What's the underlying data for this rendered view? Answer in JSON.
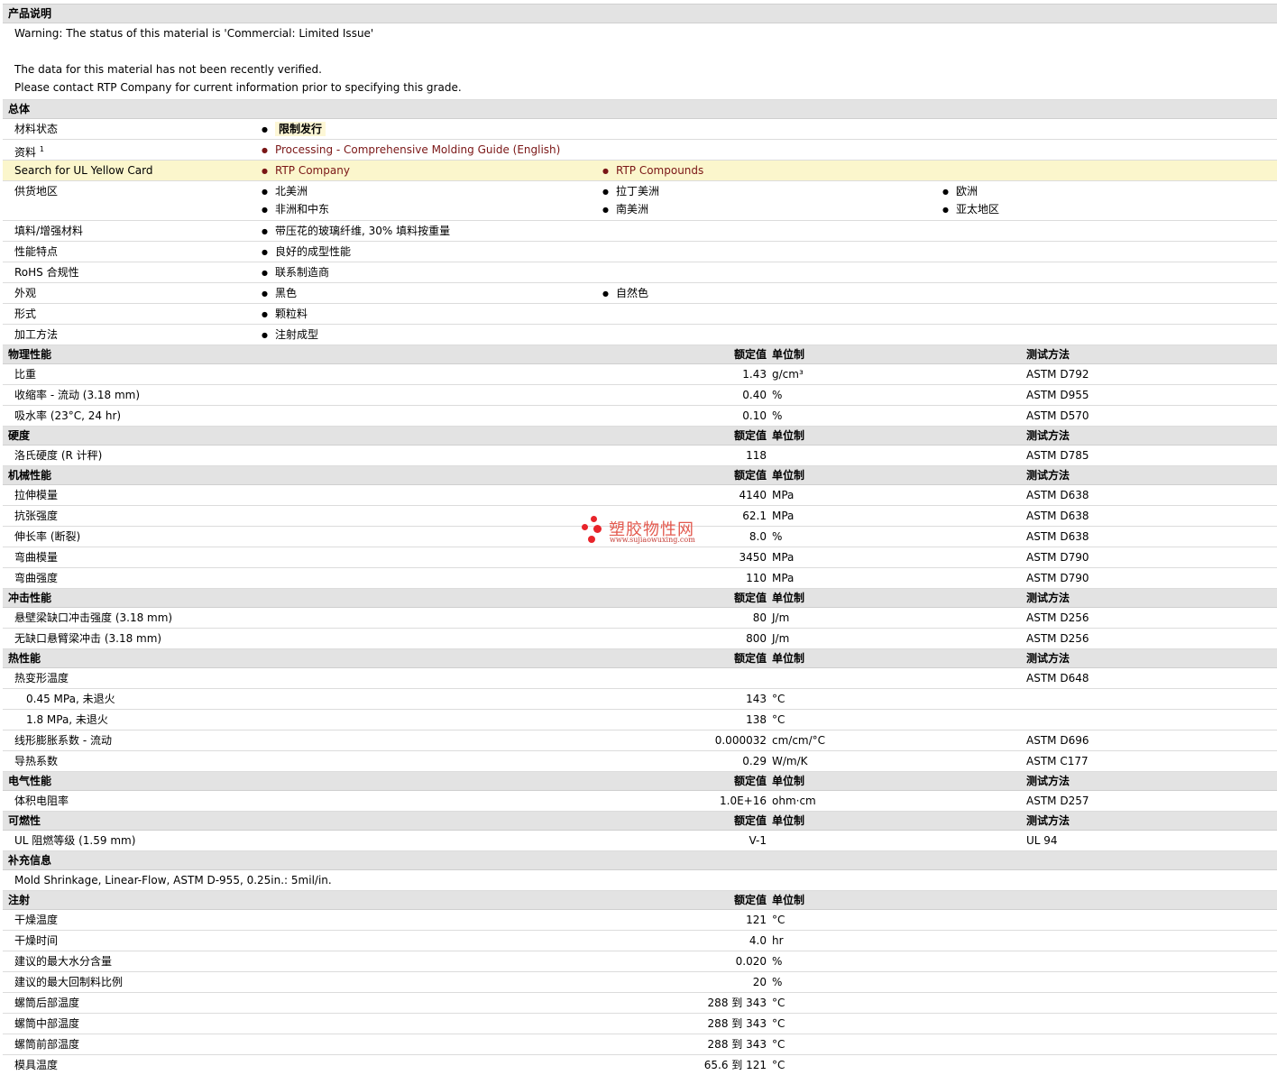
{
  "description": {
    "title": "产品说明",
    "lines": [
      "Warning: The status of this material is 'Commercial: Limited Issue'",
      "",
      "The data for this material has not been recently verified.",
      "Please contact RTP Company for current information prior to specifying this grade."
    ]
  },
  "general": {
    "title": "总体",
    "material_status_label": "材料状态",
    "material_status_value": "限制发行",
    "resources_label": "资料",
    "resources_sup": "1",
    "resources_link": "Processing - Comprehensive Molding Guide (English)",
    "ul_label": "Search for UL Yellow Card",
    "ul_link1": "RTP Company",
    "ul_link2": "RTP Compounds",
    "region_label": "供货地区",
    "regions": [
      "北美洲",
      "拉丁美洲",
      "欧洲",
      "非洲和中东",
      "南美洲",
      "亚太地区"
    ],
    "filler_label": "填料/增强材料",
    "filler_value": "带压花的玻璃纤维, 30% 填料按重量",
    "features_label": "性能特点",
    "features_value": "良好的成型性能",
    "rohs_label": "RoHS 合规性",
    "rohs_value": "联系制造商",
    "appearance_label": "外观",
    "appearance_values": [
      "黑色",
      "自然色"
    ],
    "form_label": "形式",
    "form_value": "颗粒料",
    "process_label": "加工方法",
    "process_value": "注射成型"
  },
  "headers": {
    "nominal": "额定值",
    "unit": "单位制",
    "test": "测试方法"
  },
  "physical": {
    "title": "物理性能",
    "rows": [
      {
        "label": "比重",
        "value": "1.43",
        "unit": "g/cm³",
        "test": "ASTM D792"
      },
      {
        "label": "收缩率  - 流动  (3.18 mm)",
        "value": "0.40",
        "unit": "%",
        "test": "ASTM D955"
      },
      {
        "label": "吸水率  (23°C, 24 hr)",
        "value": "0.10",
        "unit": "%",
        "test": "ASTM D570"
      }
    ]
  },
  "hardness": {
    "title": "硬度",
    "rows": [
      {
        "label": "洛氏硬度  (R 计秤)",
        "value": "118",
        "unit": "",
        "test": "ASTM D785"
      }
    ]
  },
  "mechanical": {
    "title": "机械性能",
    "rows": [
      {
        "label": "拉伸模量",
        "value": "4140",
        "unit": "MPa",
        "test": "ASTM D638"
      },
      {
        "label": "抗张强度",
        "value": "62.1",
        "unit": "MPa",
        "test": "ASTM D638"
      },
      {
        "label": "伸长率  (断裂)",
        "value": "8.0",
        "unit": "%",
        "test": "ASTM D638"
      },
      {
        "label": "弯曲模量",
        "value": "3450",
        "unit": "MPa",
        "test": "ASTM D790"
      },
      {
        "label": "弯曲强度",
        "value": "110",
        "unit": "MPa",
        "test": "ASTM D790"
      }
    ]
  },
  "impact": {
    "title": "冲击性能",
    "rows": [
      {
        "label": "悬壁梁缺口冲击强度  (3.18 mm)",
        "value": "80",
        "unit": "J/m",
        "test": "ASTM D256"
      },
      {
        "label": "无缺口悬臂梁冲击  (3.18 mm)",
        "value": "800",
        "unit": "J/m",
        "test": "ASTM D256"
      }
    ]
  },
  "thermal": {
    "title": "热性能",
    "rows": [
      {
        "label": "热变形温度",
        "value": "",
        "unit": "",
        "test": "ASTM D648"
      },
      {
        "label": "0.45 MPa, 未退火",
        "value": "143",
        "unit": "°C",
        "test": ""
      },
      {
        "label": "1.8 MPa, 未退火",
        "value": "138",
        "unit": "°C",
        "test": ""
      },
      {
        "label": "线形膨胀系数  - 流动",
        "value": "0.000032",
        "unit": "cm/cm/°C",
        "test": "ASTM D696"
      },
      {
        "label": "导热系数",
        "value": "0.29",
        "unit": "W/m/K",
        "test": "ASTM C177"
      }
    ]
  },
  "electrical": {
    "title": "电气性能",
    "rows": [
      {
        "label": "体积电阻率",
        "value": "1.0E+16",
        "unit": "ohm·cm",
        "test": "ASTM D257"
      }
    ]
  },
  "flammability": {
    "title": "可燃性",
    "rows": [
      {
        "label": "UL 阻燃等级  (1.59 mm)",
        "value": "V-1",
        "unit": "",
        "test": "UL 94"
      }
    ]
  },
  "supplement": {
    "title": "补充信息",
    "text": "Mold Shrinkage, Linear-Flow, ASTM D-955, 0.25in.: 5mil/in."
  },
  "injection": {
    "title": "注射",
    "rows": [
      {
        "label": "干燥温度",
        "value": "121",
        "unit": "°C"
      },
      {
        "label": "干燥时间",
        "value": "4.0",
        "unit": "hr"
      },
      {
        "label": "建议的最大水分含量",
        "value": "0.020",
        "unit": "%"
      },
      {
        "label": "建议的最大回制料比例",
        "value": "20",
        "unit": "%"
      },
      {
        "label": "螺筒后部温度",
        "value": "288 到  343",
        "unit": "°C"
      },
      {
        "label": "螺筒中部温度",
        "value": "288 到  343",
        "unit": "°C"
      },
      {
        "label": "螺筒前部温度",
        "value": "288 到  343",
        "unit": "°C"
      },
      {
        "label": "模具温度",
        "value": "65.6 到  121",
        "unit": "°C"
      }
    ]
  },
  "watermark": {
    "name": "塑胶物性网",
    "url": "www.sujiaowuxing.com",
    "color": "#e8242a"
  }
}
